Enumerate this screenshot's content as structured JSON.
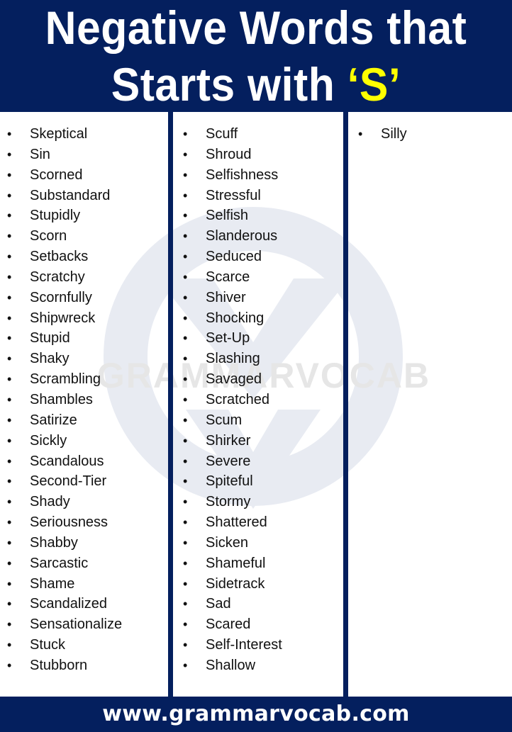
{
  "header": {
    "title_line1": "Negative Words that",
    "title_line2_prefix": "Starts with ",
    "title_accent": "‘S’",
    "background_color": "#041f5e",
    "accent_color": "#ffff00"
  },
  "watermark": {
    "text": "GRAMMARVOCAB",
    "icon": "v-circle-logo-icon"
  },
  "columns": [
    {
      "items": [
        "Skeptical",
        "Sin",
        "Scorned",
        "Substandard",
        "Stupidly",
        "Scorn",
        "Setbacks",
        "Scratchy",
        "Scornfully",
        "Shipwreck",
        "Stupid",
        "Shaky",
        "Scrambling",
        "Shambles",
        "Satirize",
        "Sickly",
        "Scandalous",
        "Second-Tier",
        "Shady",
        "Seriousness",
        "Shabby",
        "Sarcastic",
        "Shame",
        "Scandalized",
        "Sensationalize",
        "Stuck",
        "Stubborn"
      ]
    },
    {
      "items": [
        "Scuff",
        "Shroud",
        "Selfishness",
        "Stressful",
        "Selfish",
        "Slanderous",
        "Seduced",
        "Scarce",
        "Shiver",
        "Shocking",
        "Set-Up",
        "Slashing",
        "Savaged",
        "Scratched",
        "Scum",
        "Shirker",
        "Severe",
        "Spiteful",
        "Stormy",
        "Shattered",
        "Sicken",
        "Shameful",
        "Sidetrack",
        "Sad",
        "Scared",
        "Self-Interest",
        "Shallow"
      ]
    },
    {
      "items": [
        "Silly"
      ]
    }
  ],
  "bullet_glyph": "•",
  "footer": {
    "url": "www.grammarvocab.com"
  }
}
